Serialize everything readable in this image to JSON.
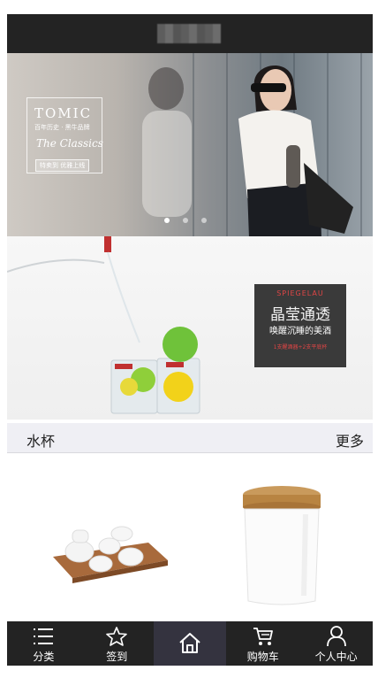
{
  "header": {
    "title": ""
  },
  "hero": {
    "brand": "TOMIC",
    "brand_sub": "百年历史 · 黑牛品牌",
    "script": "The Classics",
    "tag": "特卖到 优雅上线",
    "slides": 3,
    "active_slide": 1
  },
  "banner2": {
    "kicker": "SPIEGELAU",
    "title": "晶莹通透",
    "subtitle": "唤醒沉睡的美酒",
    "note": "1支醒酒器+2支平底杯"
  },
  "section": {
    "title": "水杯",
    "more": "更多"
  },
  "tabbar": {
    "items": [
      {
        "label": "分类",
        "icon": "list-icon"
      },
      {
        "label": "签到",
        "icon": "star-icon"
      },
      {
        "label": "",
        "icon": "home-icon",
        "active": true
      },
      {
        "label": "购物车",
        "icon": "cart-icon"
      },
      {
        "label": "个人中心",
        "icon": "person-icon"
      }
    ]
  },
  "colors": {
    "bar": "#232323",
    "active_tab": "#34333f",
    "section_bg": "#efeff4"
  }
}
